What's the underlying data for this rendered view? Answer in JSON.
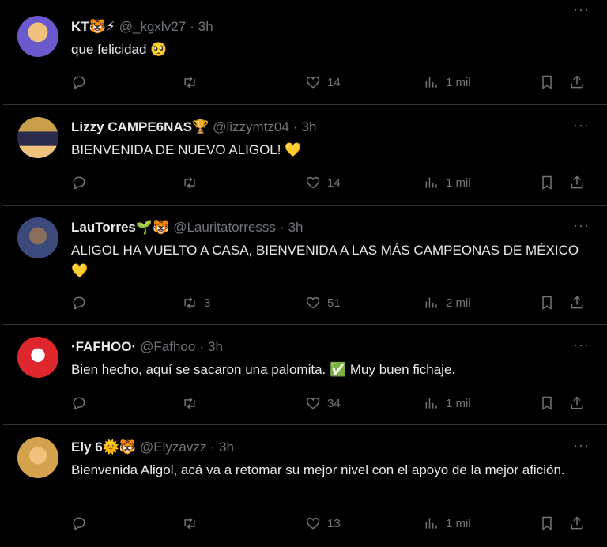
{
  "more_glyph": "···",
  "tweets": [
    {
      "name": "KT🐯⚡",
      "handle": "@_kgxlv27",
      "dot": "·",
      "time": "3h",
      "text": "que felicidad 🥺",
      "replies": "",
      "retweets": "",
      "likes": "14",
      "views": "1 mil",
      "avatar_color": "#6a5acd"
    },
    {
      "name": "Lizzy CAMPE6NAS🏆",
      "handle": "@lizzymtz04",
      "dot": "·",
      "time": "3h",
      "text": "BIENVENIDA DE NUEVO ALIGOL! 💛",
      "replies": "",
      "retweets": "",
      "likes": "14",
      "views": "1 mil",
      "avatar_color": "#c9a04a"
    },
    {
      "name": "LauTorres🌱🐯",
      "handle": "@Lauritatorresss",
      "dot": "·",
      "time": "3h",
      "text": "ALIGOL HA VUELTO A CASA, BIENVENIDA A LAS MÁS CAMPEONAS DE MÉXICO 💛",
      "replies": "",
      "retweets": "3",
      "likes": "51",
      "views": "2 mil",
      "avatar_color": "#4a5a8a"
    },
    {
      "name": "·FAFHOO·",
      "handle": "@Fafhoo",
      "dot": "·",
      "time": "3h",
      "text": "Bien hecho, aquí se sacaron una palomita. ✅ Muy buen fichaje.",
      "replies": "",
      "retweets": "",
      "likes": "34",
      "views": "1 mil",
      "avatar_color": "#e0262d"
    },
    {
      "name": "Ely 6🌞🐯",
      "handle": "@Elyzavzz",
      "dot": "·",
      "time": "3h",
      "text": "Bienvenida Aligol, acá va a retomar su mejor nivel con el apoyo de la mejor afición.",
      "replies": "",
      "retweets": "",
      "likes": "13",
      "views": "1 mil",
      "avatar_color": "#d4a24c"
    }
  ]
}
